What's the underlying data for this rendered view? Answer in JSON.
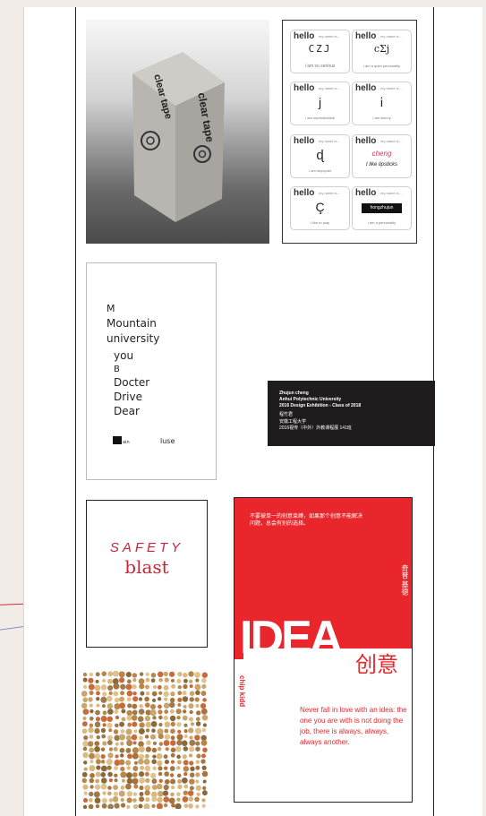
{
  "tape_box": {
    "side_left": "clear tape",
    "side_right": "clear tape"
  },
  "hello_tags": [
    {
      "hello": "hello",
      "my_name": "my name is...",
      "name": "CZJ",
      "sub": "i am so serious"
    },
    {
      "hello": "hello",
      "my_name": "my name is...",
      "name": "cΣj",
      "sub": "I am a quiet personality"
    },
    {
      "hello": "hello",
      "my_name": "my name is...",
      "name": "j",
      "sub": "I am unpredictable"
    },
    {
      "hello": "hello",
      "my_name": "my name is...",
      "name": "ⅰ",
      "sub": "I am skinny"
    },
    {
      "hello": "hello",
      "my_name": "my name is...",
      "name": "ɖ",
      "sub": "I am shy/quiet"
    },
    {
      "hello": "hello",
      "my_name": "my name is...",
      "name": "cheng",
      "sub": "I like lipsticks"
    },
    {
      "hello": "hello",
      "my_name": "my name is...",
      "name": "Ç",
      "sub": "I like to play"
    },
    {
      "hello": "hello",
      "my_name": "my name is...",
      "name": "hongzhujun",
      "sub": "I am a personality"
    }
  ],
  "mountain_words": [
    "M",
    "Mountain",
    "university",
    "you",
    "B",
    "Docter",
    "Drive",
    "Dear"
  ],
  "mountain_footer": {
    "left": "ain",
    "right": "luse"
  },
  "banner_lines": [
    "Zhujun cheng",
    "Anhui Polytechnic University",
    "2016 Design Exhibition - Class of 2018",
    "程竹君",
    "安徽工程大学",
    "2016视传（中外）外教课程展 141班"
  ],
  "safety": {
    "line1": "SAFETY",
    "line2": "blast"
  },
  "idea_poster": {
    "red_text": "不要被单一的创意束缚，如果那个创意不能解决问题，总会有别的选择。",
    "vertical_cn": "奇普·基德",
    "big": "IDEA",
    "cn": "创意",
    "author": "chip kidd",
    "quote": "Never fall in love with an idea: the one you are with is not doing the job, there is always, always, always another."
  }
}
